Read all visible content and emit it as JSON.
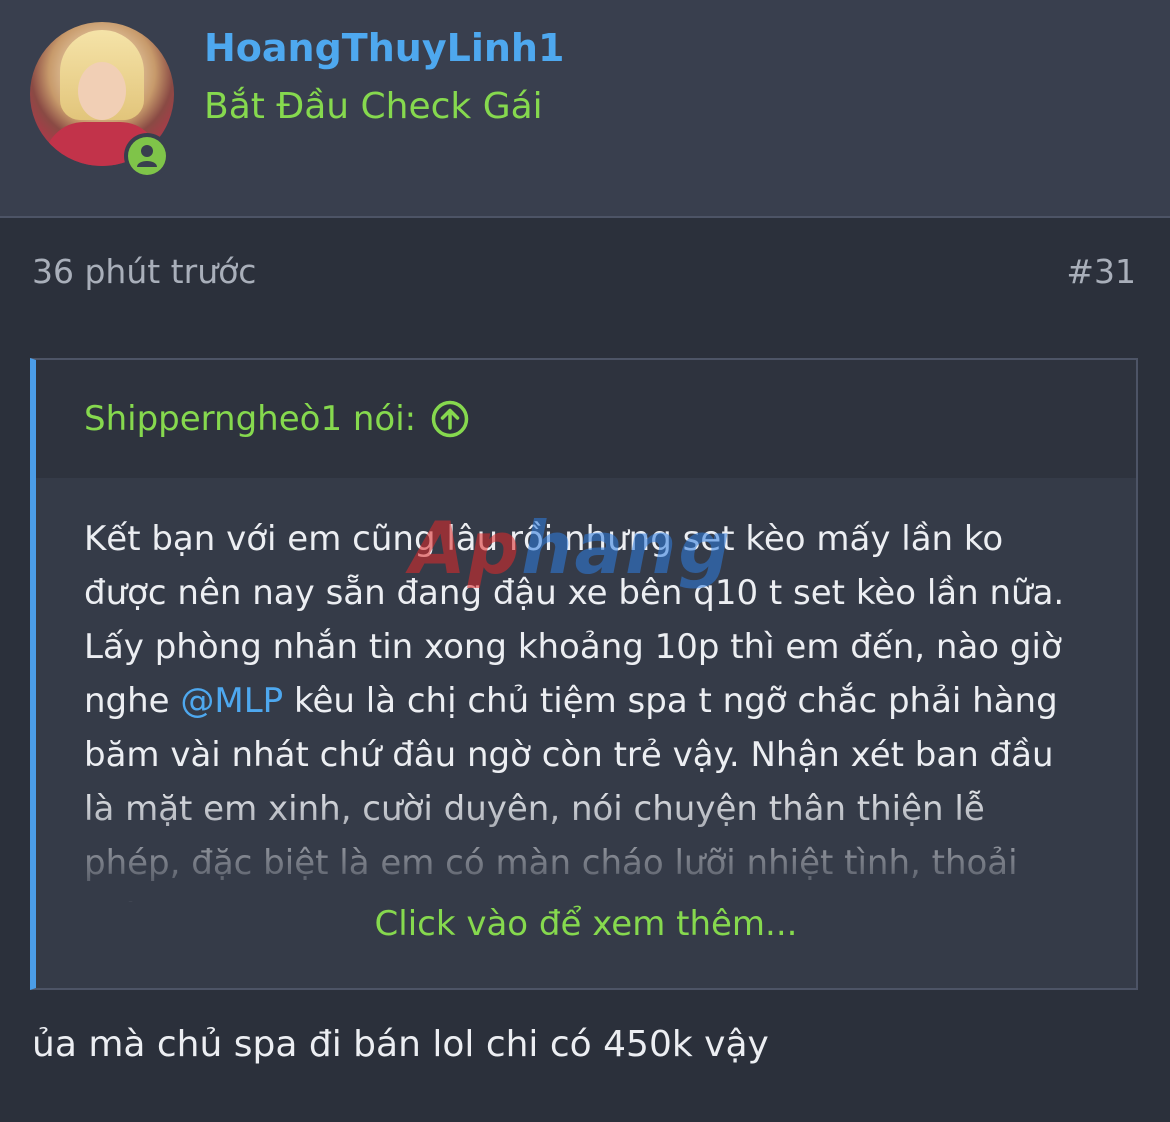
{
  "user": {
    "name": "HoangThuyLinh1",
    "title": "Bắt Đầu Check Gái",
    "avatar_icon": "avatar-image",
    "online_icon": "user-online-icon",
    "colors": {
      "name": "#4ea8ef",
      "title": "#86d94e",
      "online": "#7fc449"
    }
  },
  "post": {
    "time": "36 phút trước",
    "number": "#31"
  },
  "quote": {
    "author_label": "Shipperngheò1 nói:",
    "jump_icon": "arrow-up-circle-icon",
    "text_before_mention": "Kết bạn với em cũng lâu rồi nhưng set kèo mấy lần ko được nên nay sẵn đang đậu xe bên q10 t set kèo lần nữa. Lấy phòng nhắn tin xong khoảng 10p thì em đến, nào giờ nghe ",
    "mention": "@MLP",
    "text_after_mention": " kêu là chị chủ tiệm spa t ngỡ chắc phải hàng băm vài nhát chứ đâu ngờ còn trẻ vậy. Nhận xét ban đầu là mặt em xinh, cười duyên, nói chuyện thân thiện lễ phép, đặc biệt là em có màn cháo lưỡi nhiệt tình, thoải mái,",
    "expand_label": "Click vào để xem thêm...",
    "accent_color": "#4b9de8"
  },
  "watermark": {
    "part1": "Ap",
    "part2": "hang"
  },
  "reply": {
    "text": "ủa mà chủ spa đi bán lol chi có 450k vậy"
  }
}
